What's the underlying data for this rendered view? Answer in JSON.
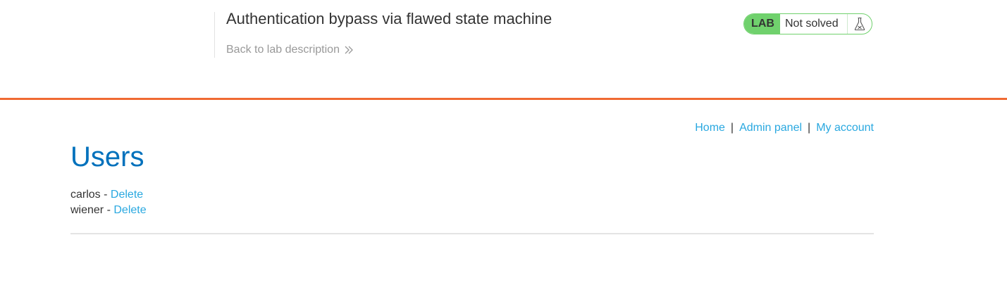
{
  "lab_header": {
    "title": "Authentication bypass via flawed state machine",
    "back_link": "Back to lab description",
    "status": {
      "badge": "LAB",
      "text": "Not solved",
      "icon": "flask-icon",
      "accent_color": "#70d16d"
    }
  },
  "nav": {
    "home": "Home",
    "separator": "|",
    "admin_panel": "Admin panel",
    "my_account": "My account"
  },
  "page": {
    "heading": "Users",
    "dash": " - ",
    "users": [
      {
        "name": "carlos",
        "action": "Delete"
      },
      {
        "name": "wiener",
        "action": "Delete"
      }
    ]
  },
  "colors": {
    "header_border": "#f06a32",
    "link": "#29a8e0",
    "heading": "#0071bc"
  }
}
